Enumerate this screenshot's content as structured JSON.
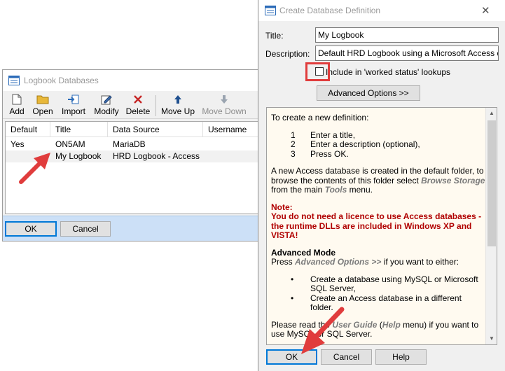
{
  "logbook_window": {
    "title": "Logbook Databases",
    "toolbar": [
      {
        "label": "Add",
        "icon": "add-icon"
      },
      {
        "label": "Open",
        "icon": "open-folder-icon"
      },
      {
        "label": "Import",
        "icon": "import-icon"
      },
      {
        "label": "Modify",
        "icon": "modify-icon"
      },
      {
        "label": "Delete",
        "icon": "delete-icon"
      },
      {
        "label": "Move Up",
        "icon": "arrow-up-icon"
      },
      {
        "label": "Move Down",
        "icon": "arrow-down-icon",
        "disabled": true
      }
    ],
    "columns": [
      "Default",
      "Title",
      "Data Source",
      "Username"
    ],
    "rows": [
      {
        "default": "Yes",
        "title": "ON5AM",
        "source": "MariaDB",
        "username": ""
      },
      {
        "default": "",
        "title": "My Logbook",
        "source": "HRD Logbook - Access",
        "username": ""
      }
    ],
    "ok_label": "OK",
    "cancel_label": "Cancel"
  },
  "create_dialog": {
    "title": "Create Database Definition",
    "close_glyph": "✕",
    "title_label": "Title:",
    "title_value": "My Logbook",
    "description_label": "Description:",
    "description_value": "Default HRD Logbook using a Microsoft Access database",
    "checkbox_label": "Include in 'worked status' lookups",
    "advanced_button": "Advanced Options >>",
    "info": {
      "intro": "To create a new definition:",
      "steps": [
        {
          "n": "1",
          "text": "Enter a title,"
        },
        {
          "n": "2",
          "text": "Enter a description (optional),"
        },
        {
          "n": "3",
          "text": "Press OK."
        }
      ],
      "access_1": "A new Access database is created in the default folder, to browse the contents of this folder select ",
      "access_em1": "Browse Storage",
      "access_2": " from the main ",
      "access_em2": "Tools",
      "access_3": " menu.",
      "note_title": "Note:",
      "note_text": "You do not need a licence to use Access databases - the runtime DLLs are included in Windows XP and VISTA!",
      "adv_title": "Advanced Mode",
      "adv_1": "Press ",
      "adv_em": "Advanced Options >>",
      "adv_2": " if you want to either:",
      "bullet_glyph": "•",
      "bullets": [
        "Create a database using MySQL or Microsoft SQL Server,",
        "Create an Access database in a different folder."
      ],
      "guide_1": "Please read the ",
      "guide_em1": "User Guide",
      "guide_2": " (",
      "guide_em2": "Help",
      "guide_3": " menu) if you want to use MySQL or SQL Server."
    },
    "ok_label": "OK",
    "cancel_label": "Cancel",
    "help_label": "Help"
  },
  "colors": {
    "annotation_red": "#e03c3c",
    "selection_bar": "#cce0f7",
    "note_red": "#b00000"
  }
}
